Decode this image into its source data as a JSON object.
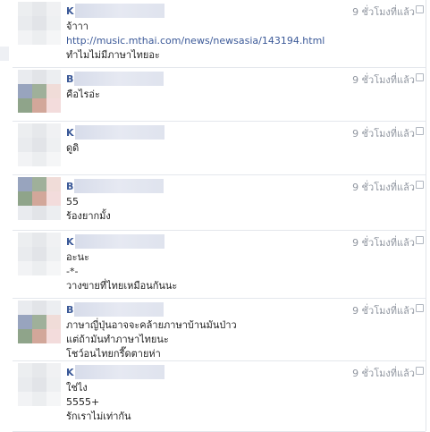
{
  "comments": [
    {
      "initial": "K",
      "time": "9 ชั่วโมงที่แล้ว",
      "lines": [
        "จ้าาา",
        "http://music.mthai.com/news/newsasia/143194.html",
        "ทำไมไม่มีภาษาไทยอะ"
      ],
      "link_line": 1,
      "avatar_colors": [
        "#eceef0",
        "#e6e8eb",
        "#f0f1f3",
        "#e9ebee",
        "#e2e4e8",
        "#eef0f2",
        "#f2f3f5",
        "#eceef0",
        "#f5f6f7"
      ]
    },
    {
      "initial": "B",
      "time": "9 ชั่วโมงที่แล้ว",
      "lines": [
        "คือไรอ่ะ"
      ],
      "avatar_colors": [
        "#e9ebef",
        "#e2e4e8",
        "#eceef1",
        "#98a4be",
        "#9fb09a",
        "#f0dcd8",
        "#8fa48a",
        "#d2a79a",
        "#f3dcdc"
      ]
    },
    {
      "initial": "K",
      "time": "9 ชั่วโมงที่แล้ว",
      "lines": [
        "ดูดิ"
      ],
      "avatar_colors": [
        "#eceef0",
        "#e6e8eb",
        "#f0f1f3",
        "#e9ebee",
        "#e2e4e8",
        "#eef0f2",
        "#f2f3f5",
        "#eceef0",
        "#f5f6f7"
      ]
    },
    {
      "initial": "B",
      "time": "9 ชั่วโมงที่แล้ว",
      "lines": [
        "55",
        "ร้องยากมั้ง"
      ],
      "avatar_colors": [
        "#98a4be",
        "#9fb09a",
        "#f0dcd8",
        "#8fa48a",
        "#d2a79a",
        "#f3dcdc",
        "#e9ebef",
        "#e2e4e8",
        "#eceef1"
      ]
    },
    {
      "initial": "K",
      "time": "9 ชั่วโมงที่แล้ว",
      "lines": [
        "อะนะ",
        "-*-",
        "วางขายที่ไทยเหมือนกันนะ"
      ],
      "avatar_colors": [
        "#eceef0",
        "#e6e8eb",
        "#f0f1f3",
        "#e9ebee",
        "#e2e4e8",
        "#eef0f2",
        "#f2f3f5",
        "#eceef0",
        "#f5f6f7"
      ]
    },
    {
      "initial": "B",
      "time": "9 ชั่วโมงที่แล้ว",
      "lines": [
        "ภาษาญี่ปุ่นอาจจะคล้ายภาษาบ้านมันป่าว",
        "แต่ถ้ามันทำภาษาไทยนะ",
        "โชว์อนไทยกรี๊ดตายห่า"
      ],
      "avatar_colors": [
        "#e9ebef",
        "#e2e4e8",
        "#eceef1",
        "#98a4be",
        "#9fb09a",
        "#f0dcd8",
        "#8fa48a",
        "#d2a79a",
        "#f3dcdc"
      ]
    },
    {
      "initial": "K",
      "time": "9 ชั่วโมงที่แล้ว",
      "lines": [
        "ใช่ไง",
        "5555+",
        "รักเราไม่เท่ากัน"
      ],
      "avatar_colors": [
        "#eceef0",
        "#e6e8eb",
        "#f0f1f3",
        "#e9ebee",
        "#e2e4e8",
        "#eef0f2",
        "#f2f3f5",
        "#eceef0",
        "#f5f6f7"
      ]
    }
  ]
}
